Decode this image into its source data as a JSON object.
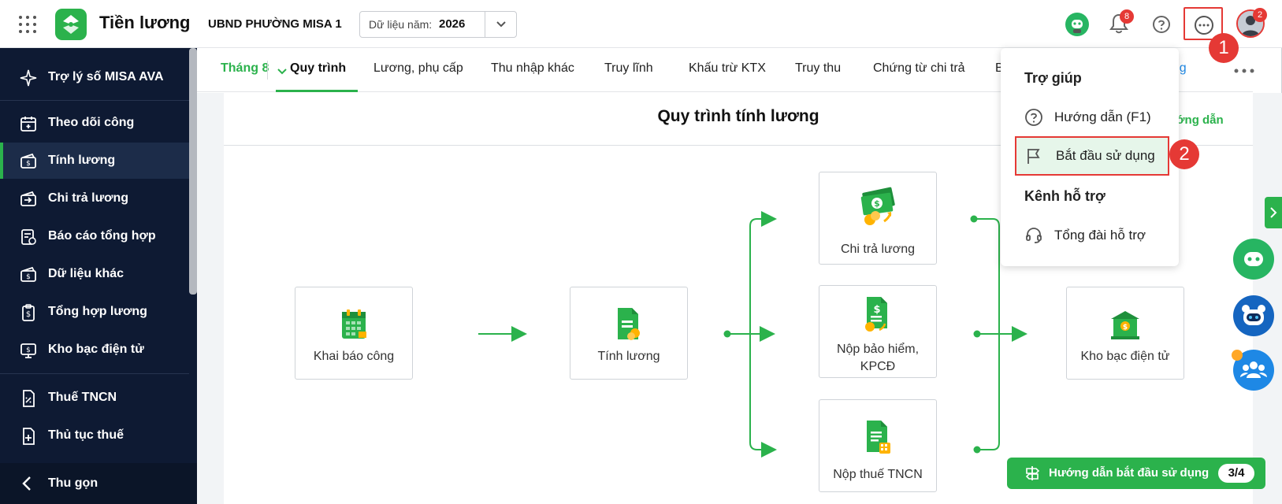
{
  "header": {
    "app_title": "Tiền lương",
    "org_name": "UBND PHƯỜNG MISA 1",
    "year_label": "Dữ liệu năm:",
    "year_value": "2026",
    "notification_count": "8",
    "avatar_badge": "2",
    "apps_icon": "grid-dots-icon",
    "help_icon": "question-circle-icon",
    "more_icon": "more-horizontal-icon"
  },
  "sidebar": {
    "items": [
      {
        "label": "Trợ lý số MISA AVA",
        "icon": "sparkle-icon"
      },
      {
        "label": "Theo dõi công",
        "icon": "calendar-icon"
      },
      {
        "label": "Tính lương",
        "icon": "money-icon",
        "active": true
      },
      {
        "label": "Chi trả lương",
        "icon": "wallet-icon"
      },
      {
        "label": "Báo cáo tổng hợp",
        "icon": "report-icon"
      },
      {
        "label": "Dữ liệu khác",
        "icon": "data-icon"
      },
      {
        "label": "Tổng hợp lương",
        "icon": "clipboard-dollar-icon"
      },
      {
        "label": "Kho bạc điện tử",
        "icon": "monitor-dollar-icon"
      },
      {
        "label": "Thuế TNCN",
        "icon": "tax-icon"
      },
      {
        "label": "Thủ tục thuế",
        "icon": "file-plus-icon"
      }
    ],
    "collapse_label": "Thu gọn"
  },
  "tabs": {
    "month": "Tháng 8",
    "items": [
      "Quy trình",
      "Lương, phụ cấp",
      "Thu nhập khác",
      "Truy lĩnh",
      "Khấu trừ KTX",
      "Truy thu",
      "Chứng từ chi trả",
      "B"
    ],
    "partial_right": "động"
  },
  "main": {
    "title": "Quy trình tính lương",
    "guide_link": "ướng dẫn",
    "steps": {
      "khai_bao": "Khai báo công",
      "tinh_luong": "Tính lương",
      "chi_tra": "Chi trả lương",
      "nop_bh_line1": "Nộp bảo hiểm,",
      "nop_bh_line2": "KPCĐ",
      "nop_thue": "Nộp thuế TNCN",
      "kho_bac": "Kho bạc điện tử"
    }
  },
  "dropdown": {
    "section1": "Trợ giúp",
    "help_item": "Hướng dẫn (F1)",
    "start_item": "Bắt đầu sử dụng",
    "section2": "Kênh hỗ trợ",
    "hotline_item": "Tổng đài hỗ trợ"
  },
  "callouts": {
    "one": "1",
    "two": "2"
  },
  "start_guide": {
    "label": "Hướng dẫn bắt đầu sử dụng",
    "progress": "3/4"
  },
  "colors": {
    "brand_green": "#2bb24c",
    "sidebar_bg": "#0e1a33",
    "alert_red": "#e53935"
  }
}
